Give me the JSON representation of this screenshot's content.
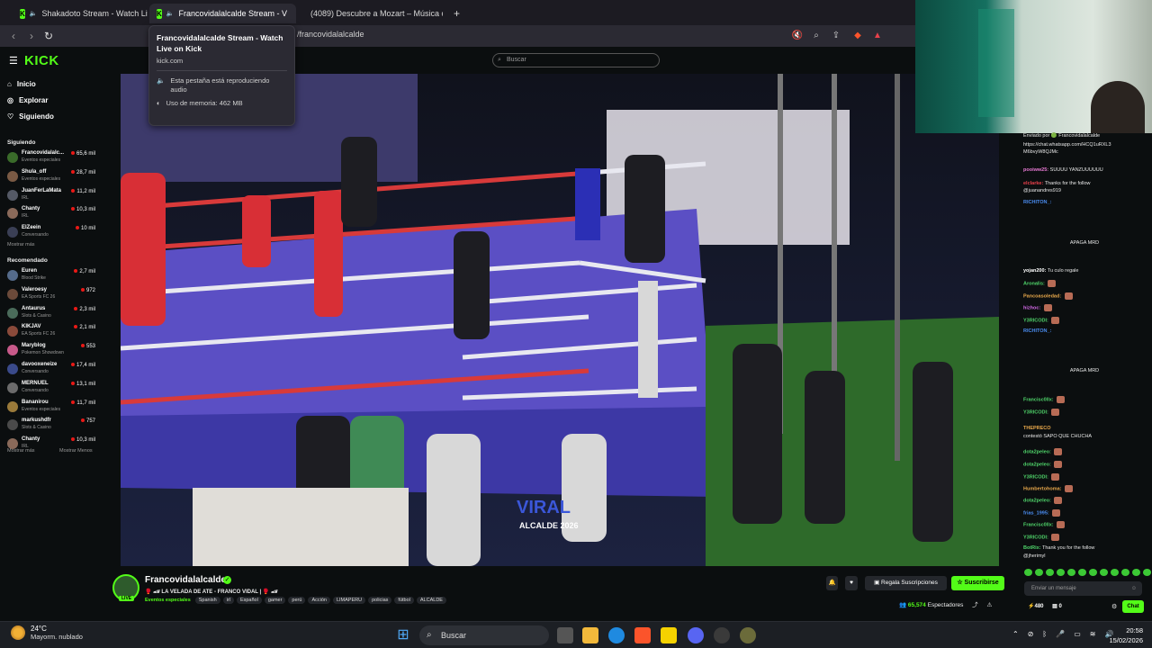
{
  "browser": {
    "tabs": [
      {
        "title": "Shakadoto Stream - Watch Live o",
        "favicon": "kick-icon"
      },
      {
        "title": "Francovidalalcalde Stream - V",
        "favicon": "kick-icon",
        "active": true
      },
      {
        "title": "(4089) Descubre a Mozart – Música c",
        "favicon": "youtube-icon"
      }
    ],
    "url": "/francovidalalcalde",
    "tooltip": {
      "title": "Francovidalalcalde Stream - Watch Live on Kick",
      "domain": "kick.com",
      "audio": "Esta pestaña está reproduciendo audio",
      "memory": "Uso de memoria: 462 MB"
    }
  },
  "kick": {
    "logo": "KICK",
    "search_placeholder": "Buscar",
    "nav": [
      "Inicio",
      "Explorar",
      "Siguiendo"
    ],
    "following_header": "Siguiendo",
    "following": [
      {
        "name": "Francovidalalc...",
        "category": "Eventos especiales",
        "viewers": "65,6 mil",
        "color": "#3a6b2a"
      },
      {
        "name": "Shula_off",
        "category": "Eventos especiales",
        "viewers": "28,7 mil",
        "color": "#7a5a44"
      },
      {
        "name": "JuanFerLaMata",
        "category": "IRL",
        "viewers": "11,2 mil",
        "color": "#555a66"
      },
      {
        "name": "Chanty",
        "category": "IRL",
        "viewers": "10,3 mil",
        "color": "#8a6a5a"
      },
      {
        "name": "ElZeein",
        "category": "Conversando",
        "viewers": "10 mil",
        "color": "#3a3f55"
      }
    ],
    "show_more": "Mostrar más",
    "recommended_header": "Recomendado",
    "recommended": [
      {
        "name": "Euren",
        "category": "Blood Strike",
        "viewers": "2,7 mil",
        "color": "#556b8a"
      },
      {
        "name": "Valeroesy",
        "category": "EA Sports FC 26",
        "viewers": "972",
        "color": "#6b4a3a"
      },
      {
        "name": "Antaurus",
        "category": "Slots & Casino",
        "viewers": "2,3 mil",
        "color": "#4a6b5a"
      },
      {
        "name": "KIKJAV",
        "category": "EA Sports FC 26",
        "viewers": "2,1 mil",
        "color": "#8a4a3a"
      },
      {
        "name": "Maryblog",
        "category": "Pokemon Showdown",
        "viewers": "553",
        "color": "#c85a8a"
      },
      {
        "name": "davooxeneize",
        "category": "Conversando",
        "viewers": "17,4 mil",
        "color": "#3a4a8a"
      },
      {
        "name": "MERNUEL",
        "category": "Conversando",
        "viewers": "13,1 mil",
        "color": "#6b6b6b"
      },
      {
        "name": "Bananirou",
        "category": "Eventos especiales",
        "viewers": "11,7 mil",
        "color": "#9a7a3a"
      },
      {
        "name": "markushdfr",
        "category": "Slots & Casino",
        "viewers": "757",
        "color": "#4a4a4a"
      },
      {
        "name": "Chanty",
        "category": "IRL",
        "viewers": "10,3 mil",
        "color": "#8a6a5a"
      }
    ],
    "show_more2": "Mostrar más",
    "show_less": "Mostrar Menos"
  },
  "stream": {
    "name": "Francovidalalcalde",
    "live_badge": "LIVE",
    "title": "🥊 🏎 LA VELADA DE ATE - FRANCO VIDAL | 🥊 🏎",
    "category": "Eventos especiales",
    "tags": [
      "Spanish",
      "irl",
      "Español",
      "gamer",
      "perú",
      "Acción",
      "LIMAPERU",
      "policias",
      "fútbol",
      "ALCALDE"
    ],
    "gift_label": "Regala Suscripciones",
    "subscribe_label": "Suscribirse",
    "viewers": "65,574",
    "viewers_label": "Espectadores",
    "overlay_text": [
      "VIRAL",
      "ALCALDE 2026"
    ]
  },
  "chat": {
    "lines": [
      {
        "user": "",
        "text": "Enviado por 🟢 Francovidalalcalde",
        "user_color": "#ffffff"
      },
      {
        "user": "",
        "text": "https://chat.whatsapp.com/HCQ1uRXL3",
        "user_color": "#ffffff"
      },
      {
        "user": "",
        "text": "M6bvyW8QJMc",
        "user_color": "#ffffff"
      },
      {
        "user": "pooiww25:",
        "text": "SUUUU YANZUUUUUU",
        "user_color": "#e87ad4"
      },
      {
        "user": "elclarke:",
        "text": "Thanks for the follow",
        "user_color": "#e8414b"
      },
      {
        "user": "",
        "text": "@juanandres919",
        "user_color": "#ffffff"
      },
      {
        "user": "RICHITON_:",
        "text": "",
        "user_color": "#4a8cf0"
      },
      {
        "user": "",
        "text": "APAGA MRD",
        "user_color": "#ffffff"
      },
      {
        "user": "yojan200:",
        "text": "Tu culo regale",
        "user_color": "#ffffff"
      },
      {
        "user": "Aronalis:",
        "text": "",
        "user_color": "#4fd46a"
      },
      {
        "user": "Pancoasoledad:",
        "text": "",
        "user_color": "#e8a84b"
      },
      {
        "user": "hizhoc:",
        "text": "",
        "user_color": "#d46ae8"
      },
      {
        "user": "Y3RICODI:",
        "text": "",
        "user_color": "#4fd46a"
      },
      {
        "user": "RICHITON_:",
        "text": "",
        "user_color": "#4a8cf0"
      },
      {
        "user": "",
        "text": "APAGA MRD",
        "user_color": "#ffffff"
      },
      {
        "user": "Francisc0llx:",
        "text": "",
        "user_color": "#4fd46a"
      },
      {
        "user": "Y3RICODI:",
        "text": "",
        "user_color": "#4fd46a"
      },
      {
        "user": "THEPRECO",
        "text": "",
        "user_color": "#e8a84b"
      },
      {
        "user": "",
        "text": "contestó SAPO QUE CHUCHA",
        "user_color": "#ffffff"
      },
      {
        "user": "dota2peleo:",
        "text": "",
        "user_color": "#4fd46a"
      },
      {
        "user": "dota2peleo:",
        "text": "",
        "user_color": "#4fd46a"
      },
      {
        "user": "Y3RICODI:",
        "text": "",
        "user_color": "#4fd46a"
      },
      {
        "user": "Humbertohoma:",
        "text": "",
        "user_color": "#e8a84b"
      },
      {
        "user": "dota2peleo:",
        "text": "",
        "user_color": "#4fd46a"
      },
      {
        "user": "frias_1995:",
        "text": "",
        "user_color": "#4a8cf0"
      },
      {
        "user": "Francisc0llx:",
        "text": "",
        "user_color": "#4fd46a"
      },
      {
        "user": "Y3RICODI:",
        "text": "",
        "user_color": "#4fd46a"
      },
      {
        "user": "BotRix:",
        "text": "Thank you for the follow",
        "user_color": "#4fd46a"
      },
      {
        "user": "",
        "text": "@jherimyl",
        "user_color": "#ffffff"
      }
    ],
    "input_placeholder": "Enviar un mensaje",
    "points": "480",
    "messages": "0",
    "send_label": "Chat"
  },
  "taskbar": {
    "weather_temp": "24°C",
    "weather_desc": "Mayorm. nublado",
    "search_label": "Buscar",
    "time": "20:58",
    "date": "15/02/2026"
  }
}
